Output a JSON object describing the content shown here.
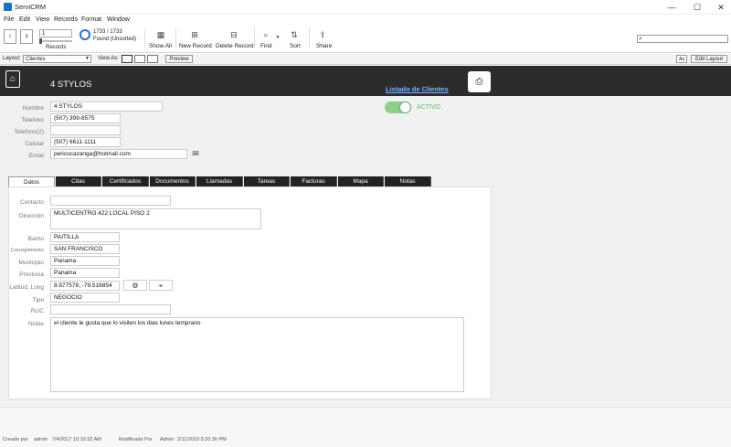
{
  "window": {
    "title": "ServiCRM",
    "minimize": "—",
    "maximize": "☐",
    "close": "✕"
  },
  "menu": [
    "File",
    "Edit",
    "View",
    "Records",
    "Format",
    "Window"
  ],
  "toolbar": {
    "prev": "‹",
    "next": "›",
    "record_number": "1",
    "records_label": "Records",
    "found_count": "1733 / 1733",
    "found_status": "Found (Unsorted)",
    "show_all": "Show All",
    "new_record": "New Record",
    "delete_record": "Delete Record",
    "find": "Find",
    "sort": "Sort",
    "share": "Share"
  },
  "layoutbar": {
    "layout_label": "Layout:",
    "layout_value": "Clientes",
    "view_as_label": "View As:",
    "preview": "Preview",
    "aa": "Aa",
    "edit_layout": "Edit Layout"
  },
  "header": {
    "title": "4 STYLOS",
    "listado_link": "Listado de Clientes"
  },
  "contact": {
    "nombre_label": "Nombre",
    "nombre": "4 STYLOS",
    "telefono_label": "Telefono",
    "telefono": "(507) 399-8575",
    "telefono2_label": "Telefono(2)",
    "telefono2": "",
    "celular_label": "Celular",
    "celular": "(507) 6611-1111",
    "email_label": "Email",
    "email": "pericocazanga@hotmail.com"
  },
  "status": {
    "label": "ACTIVO",
    "on": true,
    "color": "#8ed08a"
  },
  "tabs": [
    "Datos",
    "Citas",
    "Certificados",
    "Documentos",
    "Llamadas",
    "Tareas",
    "Facturas",
    "Mapa",
    "Notas"
  ],
  "datos": {
    "contacto_label": "Contacto",
    "contacto": "",
    "direccion_label": "Dirección",
    "direccion": "MULTICENTRO 422 LOCAL PISO 2",
    "barrio_label": "Barrio",
    "barrio": "PAITILLA",
    "corregimiento_label": "Corregimiento",
    "corregimiento": "SAN FRANCISCO",
    "municipio_label": "Municipio",
    "municipio": "Panama",
    "provincia_label": "Provincia",
    "provincia": "Panama",
    "latlong_label": "Latitud, Long",
    "latlong": "8.977578, -79.516854",
    "tipo_label": "Tipo",
    "tipo": "NEGOCIO",
    "ruc_label": "RUC",
    "ruc": "",
    "notas_label": "Notas",
    "notas": "el cliente le gusta que lo visiten los dias lunes temprano"
  },
  "footer": {
    "creado_label": "Creado por",
    "creado_user": "admin",
    "creado_date": "7/4/2017 10:10:32 AM",
    "modificado_label": "Modificado Por",
    "modificado_user": "Admin",
    "modificado_date": "2/11/2019 5:20:36 PM"
  }
}
